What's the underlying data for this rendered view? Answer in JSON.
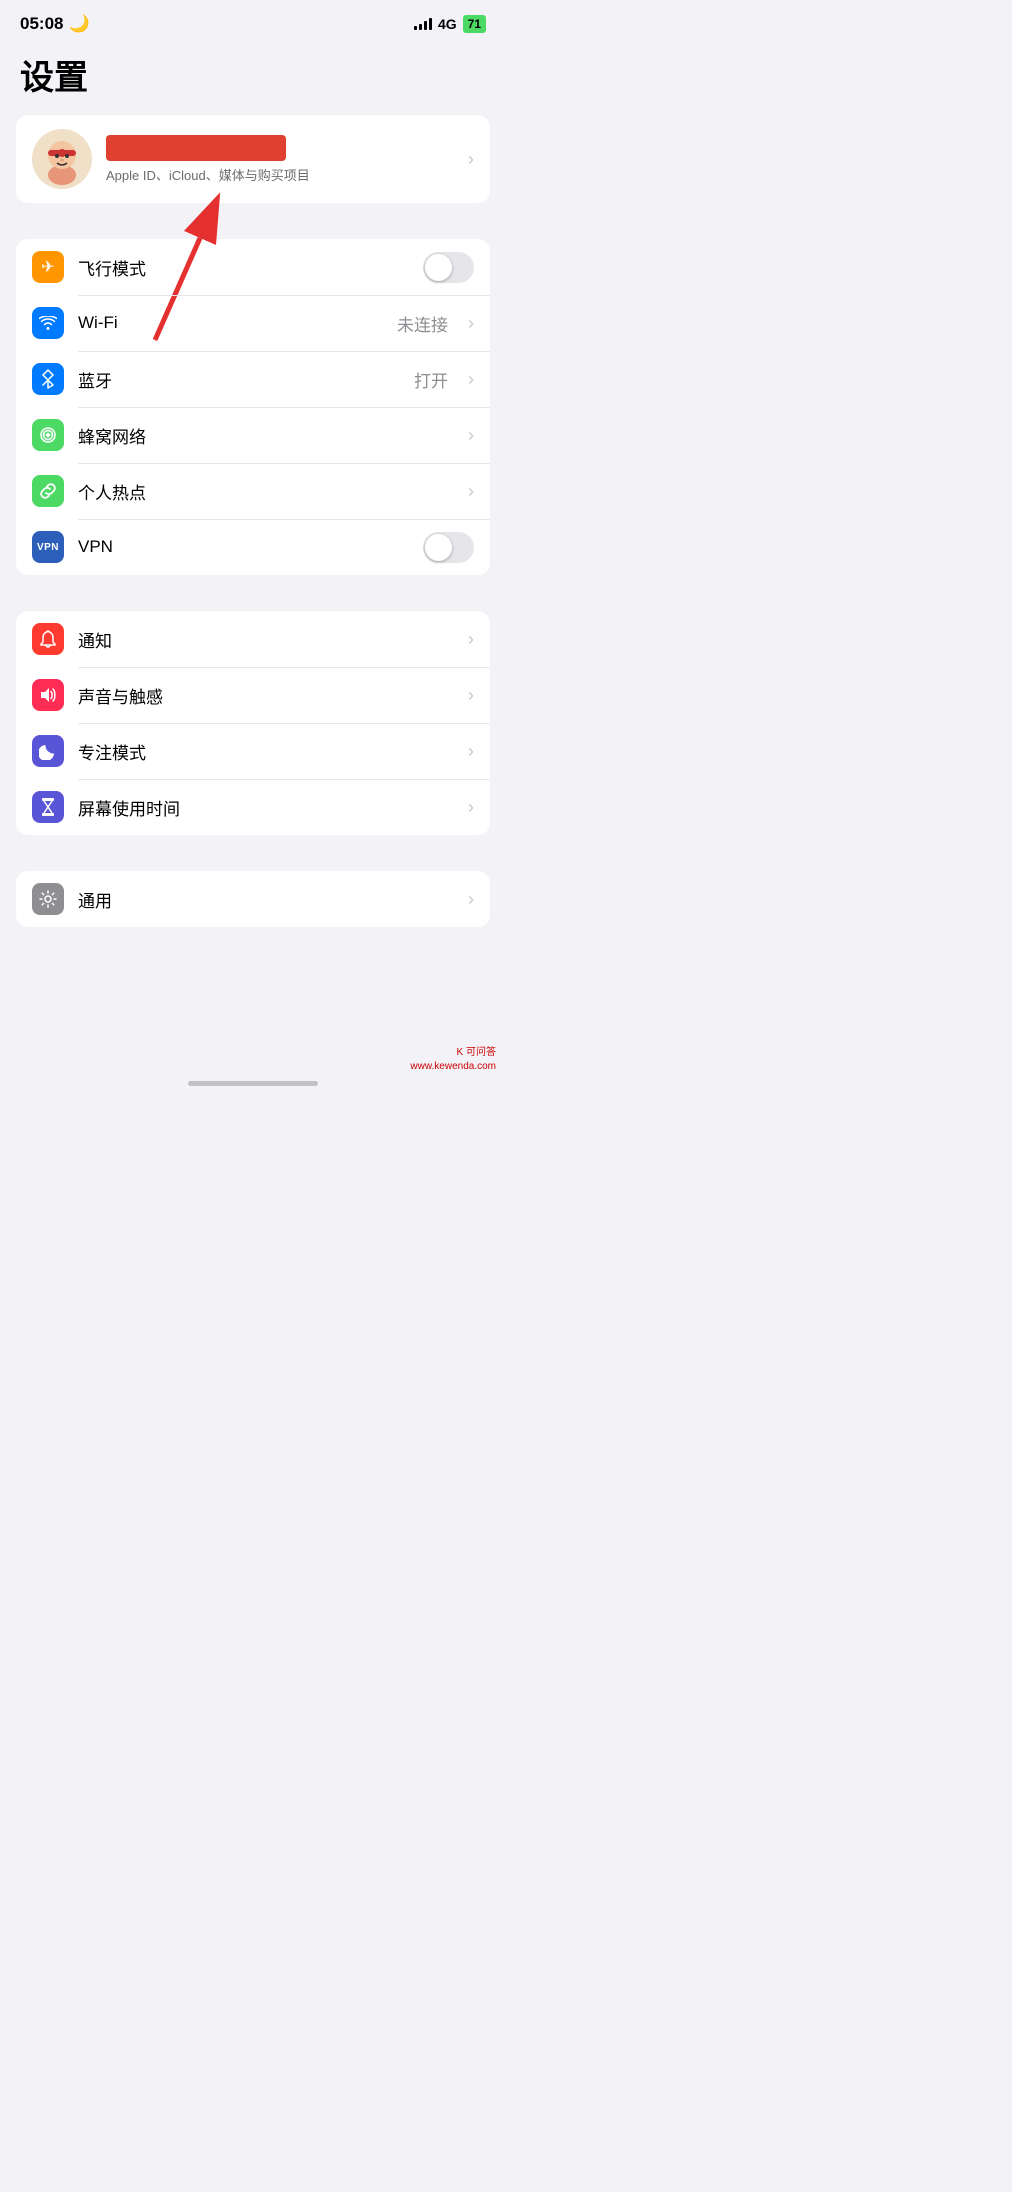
{
  "statusBar": {
    "time": "05:08",
    "moonIcon": "🌙",
    "network": "4G",
    "battery": "71"
  },
  "pageTitle": "设置",
  "appleIdSection": {
    "avatarEmoji": "🧸",
    "nameRedacted": true,
    "subtitle": "Apple ID、iCloud、媒体与购买项目"
  },
  "networkSection": [
    {
      "id": "airplane",
      "iconBg": "#ff9500",
      "iconSymbol": "✈",
      "label": "飞行模式",
      "type": "toggle",
      "value": false
    },
    {
      "id": "wifi",
      "iconBg": "#007aff",
      "iconSymbol": "wifi",
      "label": "Wi-Fi",
      "type": "detail",
      "value": "未连接"
    },
    {
      "id": "bluetooth",
      "iconBg": "#007aff",
      "iconSymbol": "bluetooth",
      "label": "蓝牙",
      "type": "detail",
      "value": "打开"
    },
    {
      "id": "cellular",
      "iconBg": "#4cd964",
      "iconSymbol": "cellular",
      "label": "蜂窝网络",
      "type": "chevron"
    },
    {
      "id": "hotspot",
      "iconBg": "#4cd964",
      "iconSymbol": "hotspot",
      "label": "个人热点",
      "type": "chevron"
    },
    {
      "id": "vpn",
      "iconBg": "#2c5fba",
      "iconSymbol": "VPN",
      "label": "VPN",
      "type": "toggle",
      "value": false
    }
  ],
  "notificationSection": [
    {
      "id": "notifications",
      "iconBg": "#ff3b30",
      "iconSymbol": "bell",
      "label": "通知",
      "type": "chevron"
    },
    {
      "id": "sounds",
      "iconBg": "#ff2d55",
      "iconSymbol": "sound",
      "label": "声音与触感",
      "type": "chevron"
    },
    {
      "id": "focus",
      "iconBg": "#5856d6",
      "iconSymbol": "moon",
      "label": "专注模式",
      "type": "chevron"
    },
    {
      "id": "screentime",
      "iconBg": "#5856d6",
      "iconSymbol": "hourglass",
      "label": "屏幕使用时间",
      "type": "chevron"
    }
  ],
  "generalSection": [
    {
      "id": "general",
      "iconBg": "#8e8e93",
      "iconSymbol": "gear",
      "label": "通用",
      "type": "chevron"
    }
  ],
  "watermark": "K 可问答\nwww.kewenda.com"
}
